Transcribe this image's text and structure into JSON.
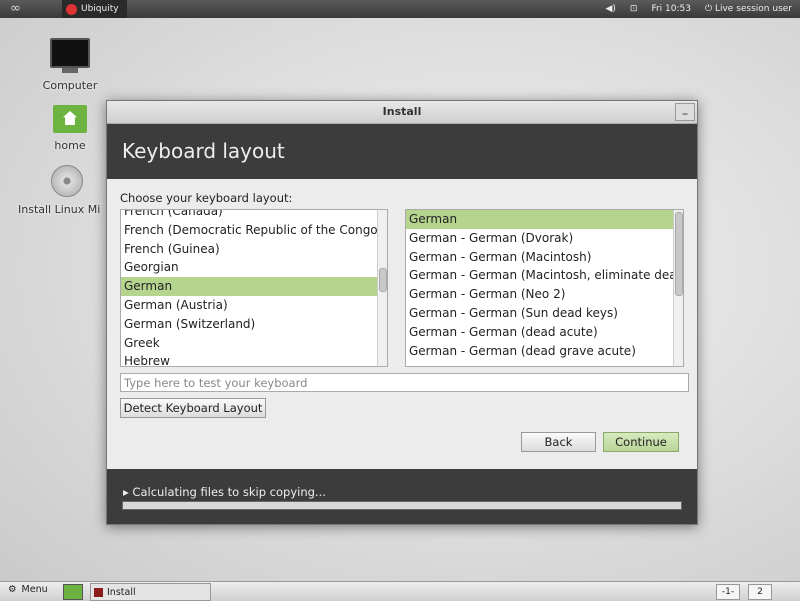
{
  "top_panel": {
    "menu_glyph": "∞",
    "active_app": "Ubiquity",
    "clock": "Fri 10:53",
    "session": "Live session user"
  },
  "desktop": {
    "icons": [
      {
        "label": "Computer",
        "icon": "computer-icon"
      },
      {
        "label": "home",
        "icon": "home-folder-icon"
      },
      {
        "label": "Install Linux Mi",
        "icon": "install-disc-icon"
      }
    ]
  },
  "window": {
    "title": "Install",
    "minimize_label": "_",
    "header": "Keyboard layout",
    "choose_label": "Choose your keyboard layout:",
    "layouts": [
      "French (Canada)",
      "French (Democratic Republic of the Congo)",
      "French (Guinea)",
      "Georgian",
      "German",
      "German (Austria)",
      "German (Switzerland)",
      "Greek",
      "Hebrew"
    ],
    "selected_layout": "German",
    "variants": [
      "German",
      "German - German (Dvorak)",
      "German - German (Macintosh)",
      "German - German (Macintosh, eliminate dead keys)",
      "German - German (Neo 2)",
      "German - German (Sun dead keys)",
      "German - German (dead acute)",
      "German - German (dead grave acute)"
    ],
    "selected_variant": "German",
    "test_placeholder": "Type here to test your keyboard",
    "detect_button": "Detect Keyboard Layout",
    "back_button": "Back",
    "continue_button": "Continue",
    "progress_text": "▸ Calculating files to skip copying...",
    "progress_fraction": 0.0
  },
  "bottom_panel": {
    "menu_label": "Menu",
    "task_label": "Install",
    "workspaces": [
      "-1-",
      "2"
    ]
  },
  "colors": {
    "selection": "#b5d58f",
    "header_bg": "#3c3c3c",
    "accent_green": "#6db33f"
  }
}
